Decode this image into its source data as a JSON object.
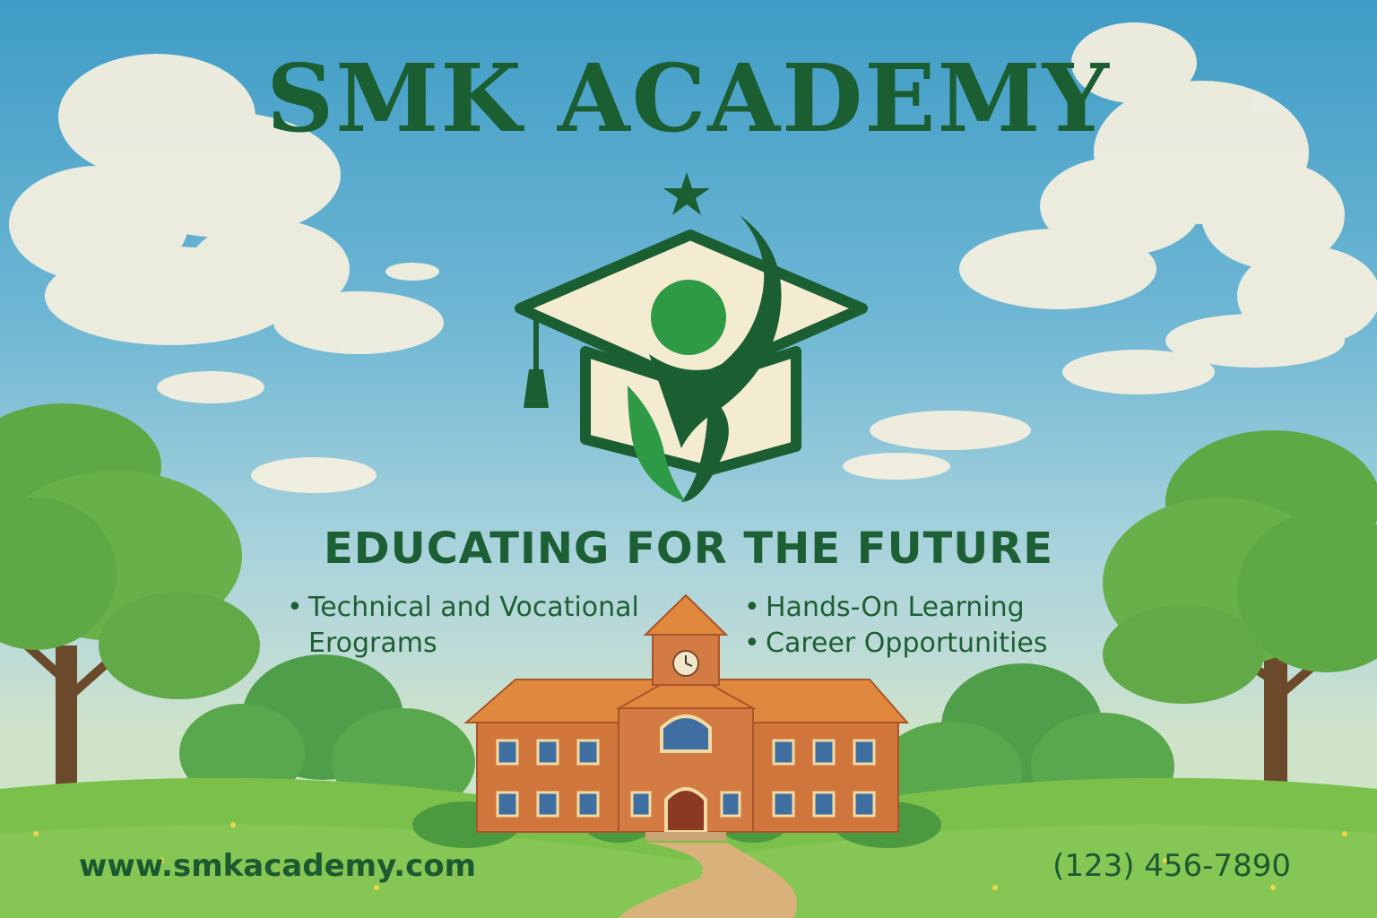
{
  "title": "SMK ACADEMY",
  "tagline": "EDUCATING FOR THE FUTURE",
  "features_left": [
    "Technical and Vocational Erograms"
  ],
  "features_right": [
    "Hands-On Learning",
    "Career Opportunities"
  ],
  "website": "www.smkacademy.com",
  "phone": "(123) 456-7890",
  "colors": {
    "brand_dark_green": "#1a5e32",
    "brand_green": "#2e9a45",
    "cream": "#f3ecd0",
    "sky": "#4fa6cc",
    "brick": "#d0763d",
    "roof": "#e0883e"
  },
  "icons": [
    "star-icon",
    "graduation-cap-logo",
    "clock-icon"
  ]
}
